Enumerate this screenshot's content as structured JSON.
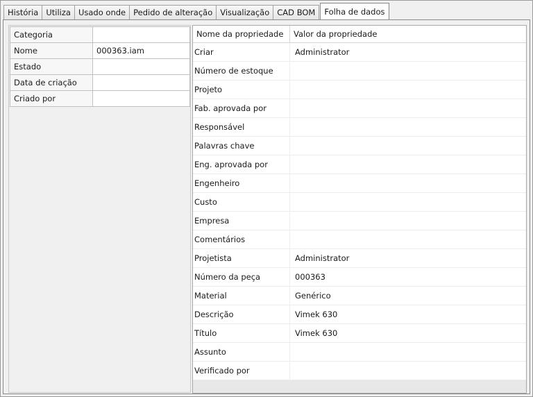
{
  "tabs": [
    {
      "label": "História"
    },
    {
      "label": "Utiliza"
    },
    {
      "label": "Usado onde"
    },
    {
      "label": "Pedido de alteração"
    },
    {
      "label": "Visualização"
    },
    {
      "label": "CAD BOM"
    },
    {
      "label": "Folha de dados",
      "active": true
    }
  ],
  "summary": [
    {
      "key": "Categoria",
      "value": ""
    },
    {
      "key": "Nome",
      "value": "000363.iam"
    },
    {
      "key": "Estado",
      "value": ""
    },
    {
      "key": "Data de criação",
      "value": ""
    },
    {
      "key": "Criado por",
      "value": ""
    }
  ],
  "properties": {
    "headers": {
      "name": "Nome da propriedade",
      "value": "Valor da propriedade"
    },
    "rows": [
      {
        "name": "Criar",
        "value": "Administrator"
      },
      {
        "name": "Número de estoque",
        "value": ""
      },
      {
        "name": "Projeto",
        "value": ""
      },
      {
        "name": "Fab. aprovada por",
        "value": ""
      },
      {
        "name": "Responsável",
        "value": ""
      },
      {
        "name": "Palavras chave",
        "value": ""
      },
      {
        "name": "Eng. aprovada por",
        "value": ""
      },
      {
        "name": "Engenheiro",
        "value": ""
      },
      {
        "name": "Custo",
        "value": ""
      },
      {
        "name": "Empresa",
        "value": ""
      },
      {
        "name": "Comentários",
        "value": ""
      },
      {
        "name": "Projetista",
        "value": "Administrator"
      },
      {
        "name": "Número da peça",
        "value": "000363"
      },
      {
        "name": "Material",
        "value": "Genérico"
      },
      {
        "name": "Descrição",
        "value": "Vimek 630"
      },
      {
        "name": "Título",
        "value": "Vimek 630"
      },
      {
        "name": "Assunto",
        "value": ""
      },
      {
        "name": "Verificado por",
        "value": ""
      }
    ]
  }
}
